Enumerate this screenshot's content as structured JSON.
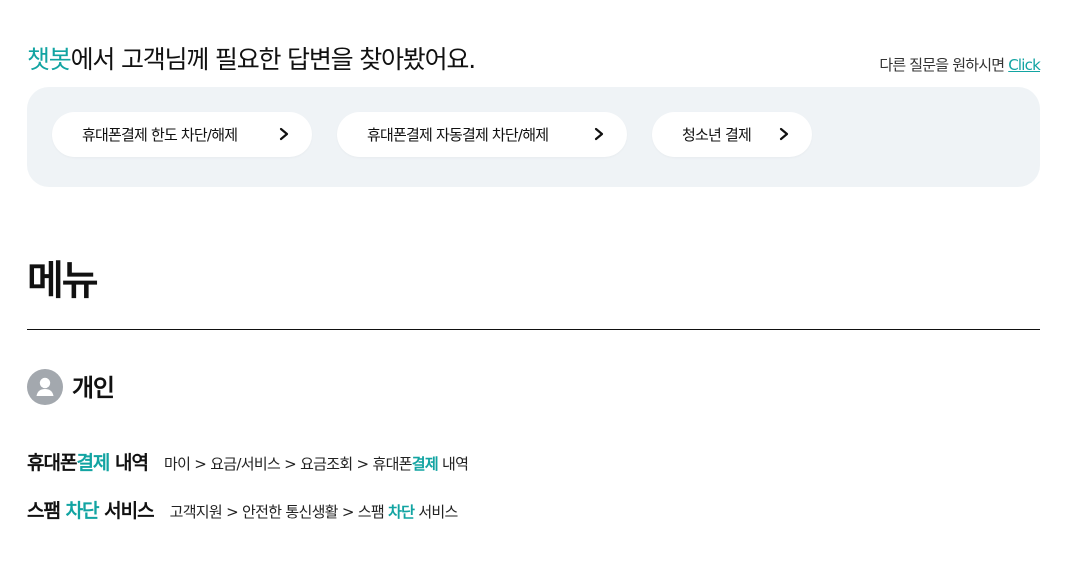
{
  "header": {
    "headline_accent": "챗봇",
    "headline_rest": "에서 고객님께 필요한 답변을 찾아봤어요.",
    "other_question_text": "다른 질문을 원하시면",
    "other_question_link": "Click"
  },
  "suggestions": [
    {
      "label": "휴대폰결제 한도 차단/해제"
    },
    {
      "label": "휴대폰결제 자동결제 차단/해제"
    },
    {
      "label": "청소년 결제"
    }
  ],
  "menu": {
    "title": "메뉴",
    "section": {
      "label": "개인",
      "icon": "person-icon"
    },
    "results": [
      {
        "name_pre": "휴대폰",
        "name_hl": "결제",
        "name_post": " 내역",
        "path_pre": "마이 > 요금/서비스 > 요금조회 > 휴대폰",
        "path_hl": "결제",
        "path_post": " 내역"
      },
      {
        "name_pre": "스팸 ",
        "name_hl": "차단",
        "name_post": " 서비스",
        "path_pre": "고객지원 > 안전한 통신생활 > 스팸 ",
        "path_hl": "차단",
        "path_post": " 서비스"
      }
    ]
  },
  "colors": {
    "accent": "#12a4a2",
    "chip_bg": "#eff3f6",
    "avatar": "#a3a8ae"
  }
}
